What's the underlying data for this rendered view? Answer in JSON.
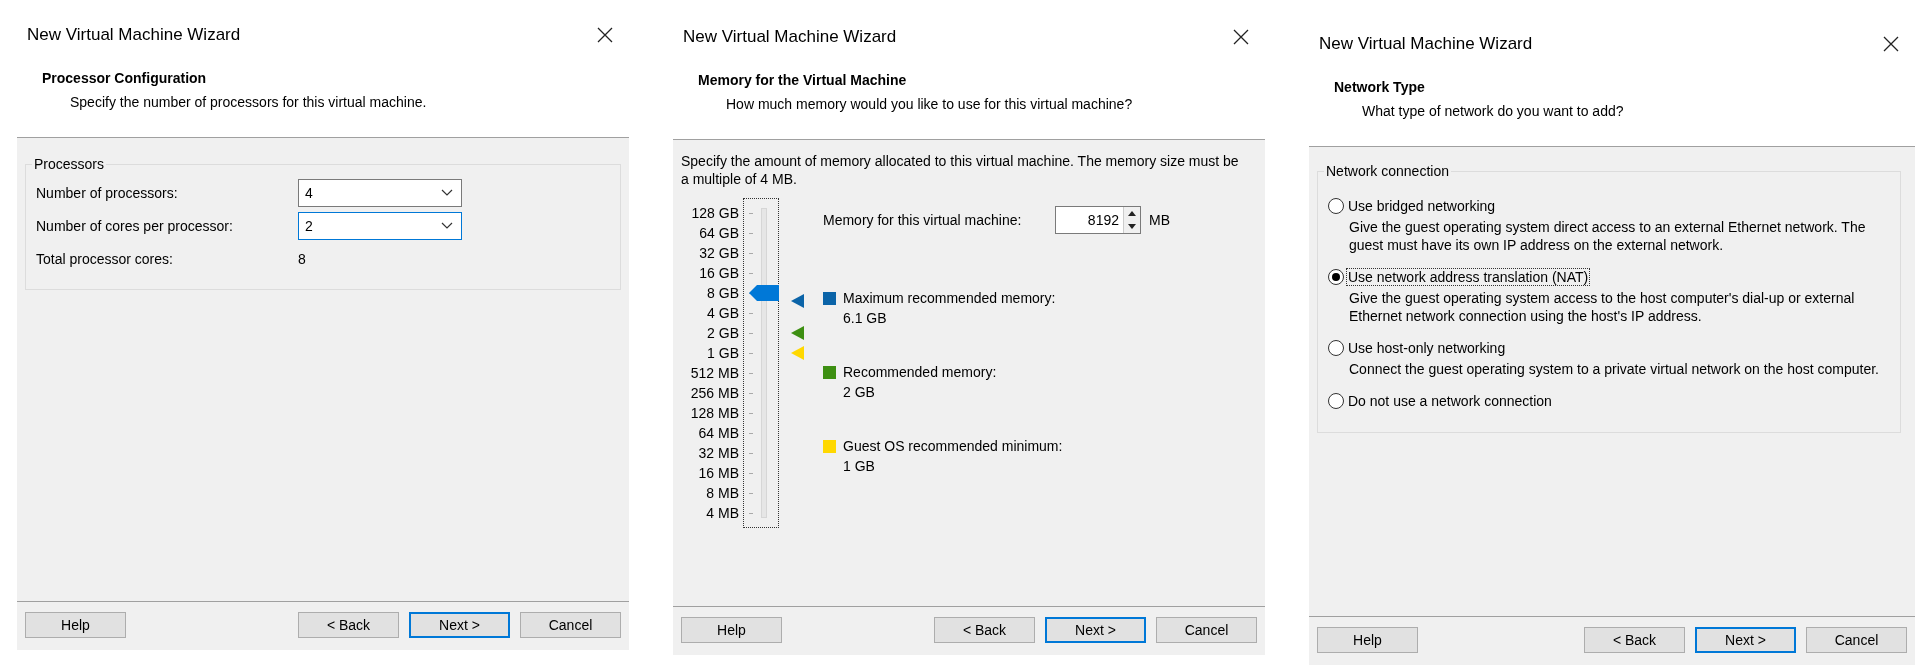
{
  "dialogs": [
    {
      "kind": "processors",
      "title": "New Virtual Machine Wizard",
      "heading": "Processor Configuration",
      "subheading": "Specify the number of processors for this virtual machine.",
      "group": {
        "label": "Processors",
        "rows": [
          {
            "kind": "dropdown",
            "label": "Number of processors:",
            "value": "4",
            "focused": false
          },
          {
            "kind": "dropdown",
            "label": "Number of cores per processor:",
            "value": "2",
            "focused": true
          },
          {
            "kind": "readout",
            "label": "Total processor cores:",
            "value": "8"
          }
        ]
      },
      "buttons": [
        {
          "label": "Help",
          "default": false
        },
        {
          "label": "< Back",
          "default": false
        },
        {
          "label": "Next >",
          "default": true
        },
        {
          "label": "Cancel",
          "default": false
        }
      ]
    },
    {
      "kind": "memory",
      "title": "New Virtual Machine Wizard",
      "heading": "Memory for the Virtual Machine",
      "subheading": "How much memory would you like to use for this virtual machine?",
      "intro": "Specify the amount of memory allocated to this virtual machine. The memory size must be a multiple of 4 MB.",
      "field": {
        "label": "Memory for this virtual machine:",
        "value": "8192",
        "unit": "MB"
      },
      "scale": [
        "128 GB",
        "64 GB",
        "32 GB",
        "16 GB",
        "8 GB",
        "4 GB",
        "2 GB",
        "1 GB",
        "512 MB",
        "256 MB",
        "128 MB",
        "64 MB",
        "32 MB",
        "16 MB",
        "8 MB",
        "4 MB"
      ],
      "slider": {
        "level": 0.733
      },
      "legend": [
        {
          "label": "Maximum recommended memory:",
          "value": "6.1 GB",
          "color": "#0b64a8",
          "level": 0.707
        },
        {
          "label": "Recommended memory:",
          "value": "2 GB",
          "color": "#3d8f12",
          "level": 0.6
        },
        {
          "label": "Guest OS recommended minimum:",
          "value": "1 GB",
          "color": "#ffd800",
          "level": 0.533
        }
      ],
      "buttons": [
        {
          "label": "Help",
          "default": false
        },
        {
          "label": "< Back",
          "default": false
        },
        {
          "label": "Next >",
          "default": true
        },
        {
          "label": "Cancel",
          "default": false
        }
      ]
    },
    {
      "kind": "network",
      "title": "New Virtual Machine Wizard",
      "heading": "Network Type",
      "subheading": "What type of network do you want to add?",
      "group": {
        "label": "Network connection",
        "options": [
          {
            "label": "Use bridged networking",
            "selected": false,
            "focused": false,
            "description": "Give the guest operating system direct access to an external Ethernet network. The guest must have its own IP address on the external network."
          },
          {
            "label": "Use network address translation (NAT)",
            "selected": true,
            "focused": true,
            "description": "Give the guest operating system access to the host computer's dial-up or external Ethernet network connection using the host's IP address."
          },
          {
            "label": "Use host-only networking",
            "selected": false,
            "focused": false,
            "description": "Connect the guest operating system to a private virtual network on the host computer."
          },
          {
            "label": "Do not use a network connection",
            "selected": false,
            "focused": false
          }
        ]
      },
      "buttons": [
        {
          "label": "Help",
          "default": false
        },
        {
          "label": "< Back",
          "default": false
        },
        {
          "label": "Next >",
          "default": true
        },
        {
          "label": "Cancel",
          "default": false
        }
      ]
    }
  ]
}
